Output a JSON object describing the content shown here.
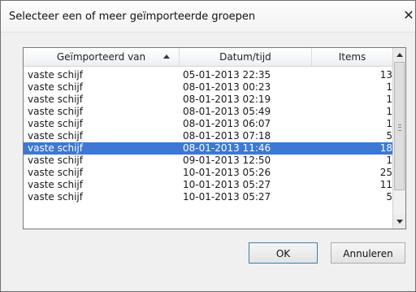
{
  "dialog": {
    "title": "Selecteer een of meer geïmporteerde groepen",
    "close_glyph": "✕"
  },
  "table": {
    "columns": [
      "Geïmporteerd van",
      "Datum/tijd",
      "Items"
    ],
    "sort_column": "Geïmporteerd van",
    "sort_direction": "ascending",
    "rows": [
      {
        "name": "vaste schijf",
        "date": "05-01-2013 22:35",
        "items": "13"
      },
      {
        "name": "vaste schijf",
        "date": "08-01-2013 00:23",
        "items": "1"
      },
      {
        "name": "vaste schijf",
        "date": "08-01-2013 02:19",
        "items": "1"
      },
      {
        "name": "vaste schijf",
        "date": "08-01-2013 05:49",
        "items": "1"
      },
      {
        "name": "vaste schijf",
        "date": "08-01-2013 06:07",
        "items": "1"
      },
      {
        "name": "vaste schijf",
        "date": "08-01-2013 07:18",
        "items": "5"
      },
      {
        "name": "vaste schijf",
        "date": "08-01-2013 11:46",
        "items": "18",
        "selected": true
      },
      {
        "name": "vaste schijf",
        "date": "09-01-2013 12:50",
        "items": "1"
      },
      {
        "name": "vaste schijf",
        "date": "10-01-2013 05:26",
        "items": "25"
      },
      {
        "name": "vaste schijf",
        "date": "10-01-2013 05:27",
        "items": "11"
      },
      {
        "name": "vaste schijf",
        "date": "10-01-2013 05:27",
        "items": "5"
      }
    ]
  },
  "buttons": {
    "ok": "OK",
    "cancel": "Annuleren"
  },
  "colors": {
    "selection": "#3b78d8",
    "dialog_bg": "#f0f0f0"
  }
}
